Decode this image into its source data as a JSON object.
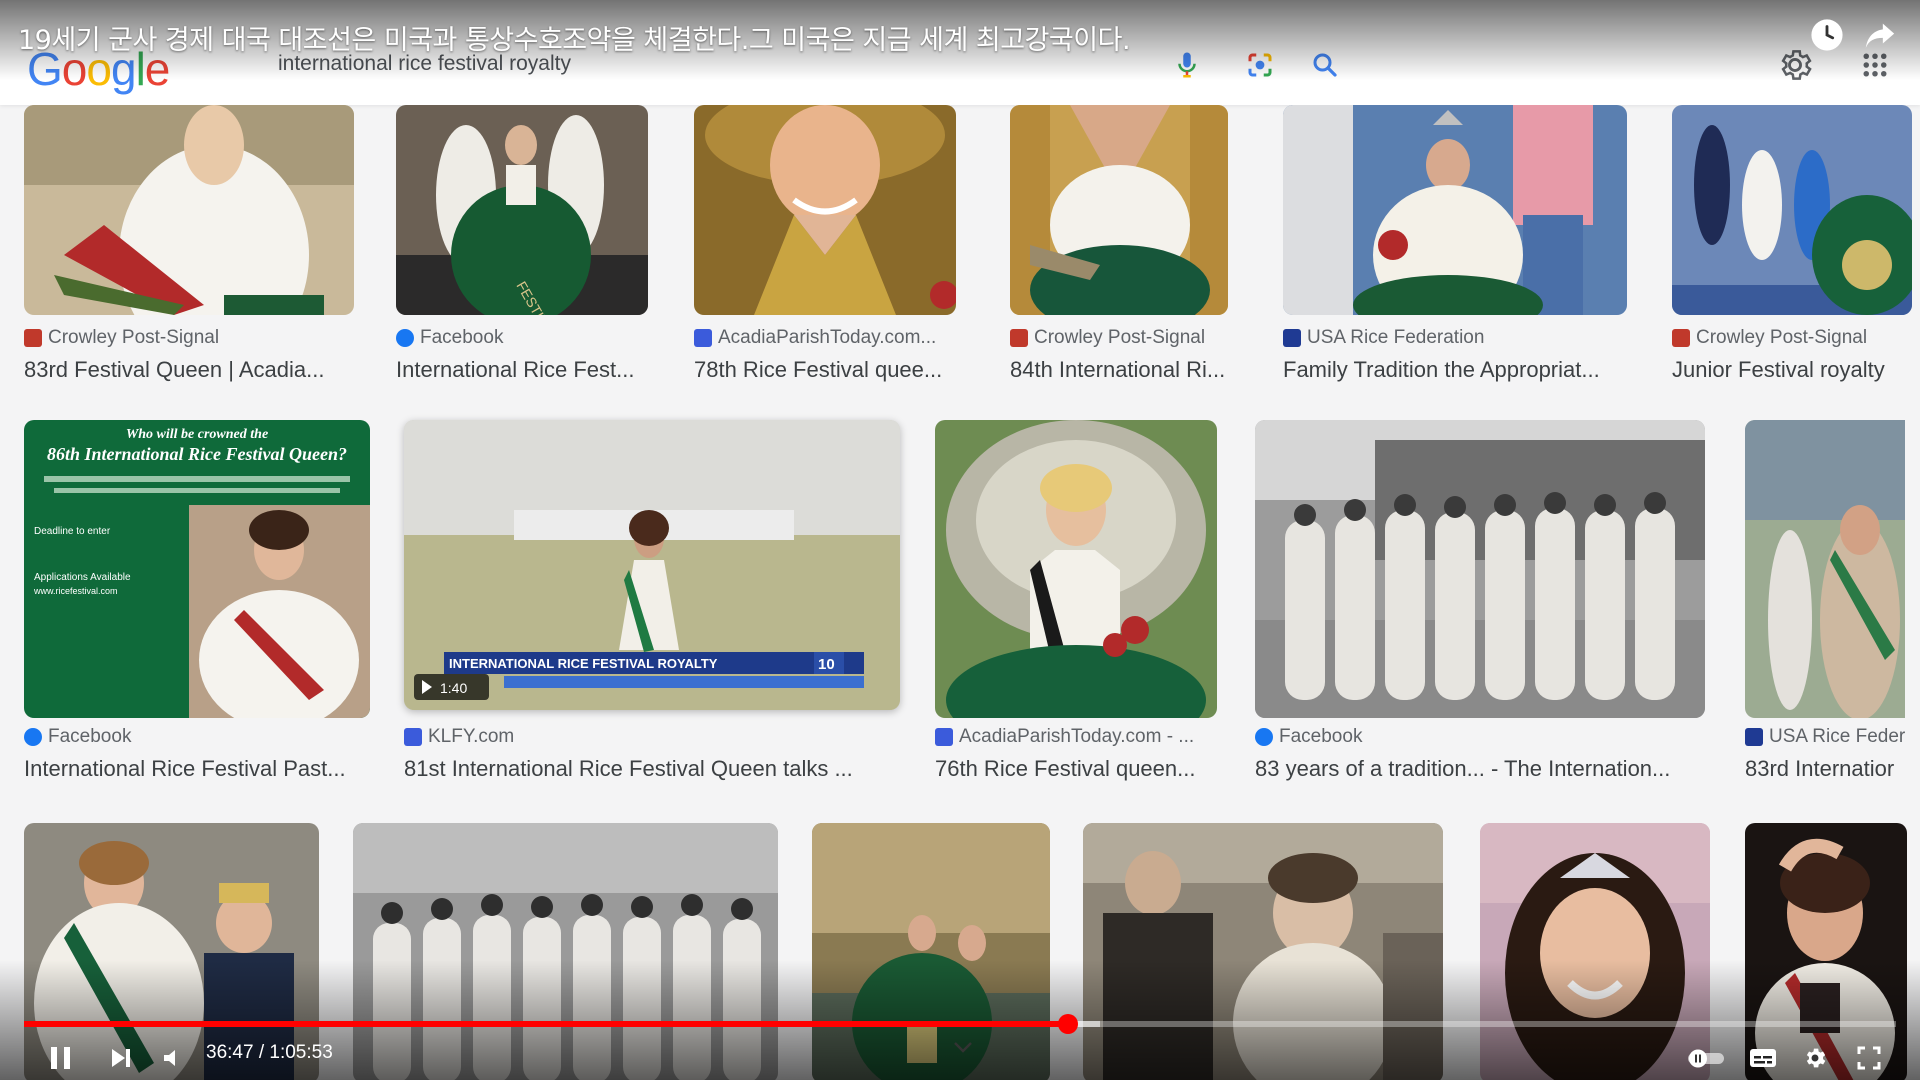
{
  "video": {
    "title": "19세기 군사 경제 대국 대조선은 미국과 통상수호조약을 체결한다.그 미국은 지금 세계 최고강국이다.",
    "time_display": "36:47 / 1:05:53",
    "progress_played_fraction": 0.5577,
    "progress_buffered_fraction": 0.575
  },
  "search": {
    "logo": [
      "G",
      "o",
      "o",
      "g",
      "l",
      "e"
    ],
    "logo_colors": [
      "#4285F4",
      "#EA4335",
      "#FBBC05",
      "#4285F4",
      "#34A853",
      "#EA4335"
    ],
    "query": "international rice festival royalty"
  },
  "results": [
    {
      "source": "Crowley Post-Signal",
      "title": "83rd Festival Queen | Acadia...",
      "favicon_color": "#c0392b"
    },
    {
      "source": "Facebook",
      "title": "International Rice Fest...",
      "favicon_color": "#1877f2"
    },
    {
      "source": "AcadiaParishToday.com...",
      "title": "78th Rice Festival quee...",
      "favicon_color": "#3b5bdb"
    },
    {
      "source": "Crowley Post-Signal",
      "title": "84th International Ri...",
      "favicon_color": "#c0392b"
    },
    {
      "source": "USA Rice Federation",
      "title": "Family Tradition the Appropriat...",
      "favicon_color": "#1f3a93"
    },
    {
      "source": "Crowley Post-Signal",
      "title": "Junior Festival royalty",
      "favicon_color": "#c0392b"
    },
    {
      "source": "Facebook",
      "title": "International Rice Festival Past...",
      "favicon_color": "#1877f2"
    },
    {
      "source": "KLFY.com",
      "title": "81st International Rice Festival Queen talks ...",
      "favicon_color": "#3b5bdb"
    },
    {
      "source": "AcadiaParishToday.com - ...",
      "title": "76th Rice Festival queen...",
      "favicon_color": "#3b5bdb"
    },
    {
      "source": "Facebook",
      "title": "83 years of a tradition... - The Internation...",
      "favicon_color": "#1877f2"
    },
    {
      "source": "USA Rice Feder",
      "title": "83rd Internatior",
      "favicon_color": "#1f3a93"
    }
  ],
  "poster": {
    "line1": "Who will be crowned the",
    "line2": "86th International Rice Festival Queen?",
    "line3": "Deadline to enter",
    "line4": "Applications Available",
    "line5": "www.ricefestival.com"
  },
  "video_thumb": {
    "banner": "INTERNATIONAL RICE FESTIVAL ROYALTY",
    "duration": "1:40",
    "channel_num": "10"
  }
}
